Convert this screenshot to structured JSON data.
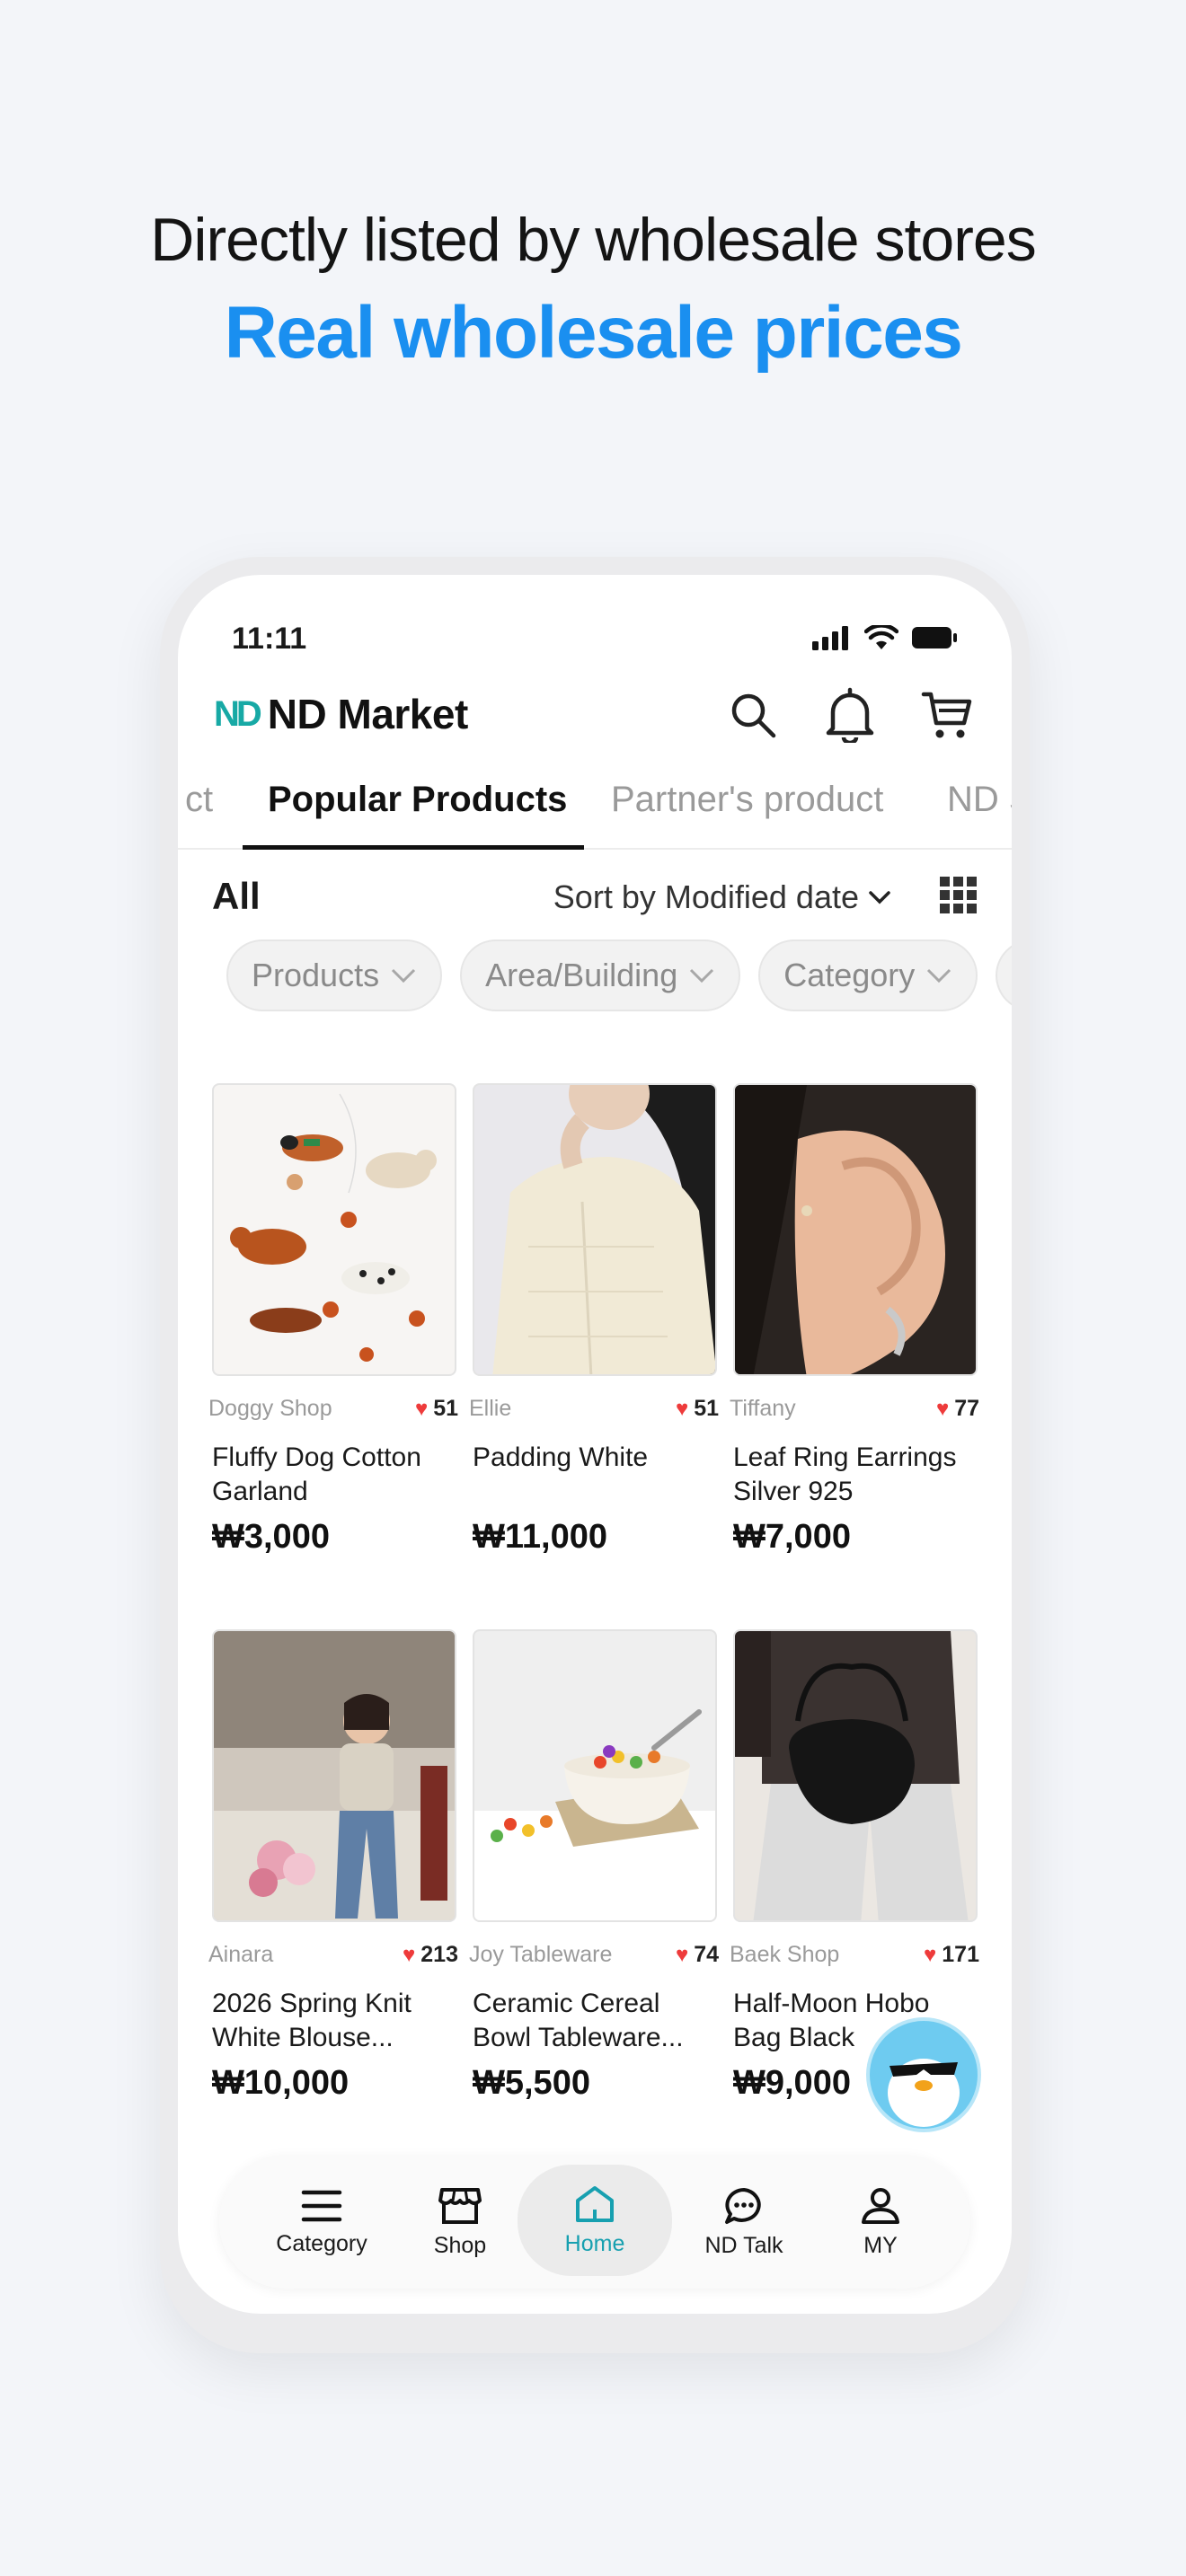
{
  "promo": {
    "line1": "Directly listed by wholesale stores",
    "line2": "Real wholesale prices"
  },
  "status_bar": {
    "time": "11:11"
  },
  "app": {
    "logo_mark": "ND",
    "name": "ND Market"
  },
  "tabs": [
    {
      "label": "ct"
    },
    {
      "label": "Popular Products"
    },
    {
      "label": "Partner's product"
    },
    {
      "label": "ND S"
    }
  ],
  "list_header": {
    "filter_label": "All",
    "sort_label": "Sort by Modified date"
  },
  "chips": [
    {
      "label": "Products"
    },
    {
      "label": "Area/Building"
    },
    {
      "label": "Category"
    }
  ],
  "products": [
    {
      "shop": "Doggy Shop",
      "likes": "51",
      "name": "Fluffy Dog Cotton Garland",
      "price": "₩3,000"
    },
    {
      "shop": "Ellie",
      "likes": "51",
      "name": "Padding White",
      "price": "₩11,000"
    },
    {
      "shop": "Tiffany",
      "likes": "77",
      "name": "Leaf Ring Earrings Silver 925",
      "price": "₩7,000"
    },
    {
      "shop": "Ainara",
      "likes": "213",
      "name": "2026 Spring Knit White Blouse...",
      "price": "₩10,000"
    },
    {
      "shop": "Joy Tableware",
      "likes": "74",
      "name": "Ceramic Cereal Bowl Tableware...",
      "price": "₩5,500"
    },
    {
      "shop": "Baek Shop",
      "likes": "171",
      "name": "Half-Moon Hobo Bag Black",
      "price": "₩9,000"
    }
  ],
  "bottom_nav": [
    {
      "label": "Category",
      "icon": "menu-icon"
    },
    {
      "label": "Shop",
      "icon": "store-icon"
    },
    {
      "label": "Home",
      "icon": "home-icon",
      "active": true
    },
    {
      "label": "ND Talk",
      "icon": "chat-icon"
    },
    {
      "label": "MY",
      "icon": "person-icon"
    }
  ],
  "colors": {
    "accent_blue": "#1a8ff0",
    "brand_teal": "#17a9a5",
    "heart_red": "#ee3b3b",
    "active_nav": "#17a0b0"
  }
}
